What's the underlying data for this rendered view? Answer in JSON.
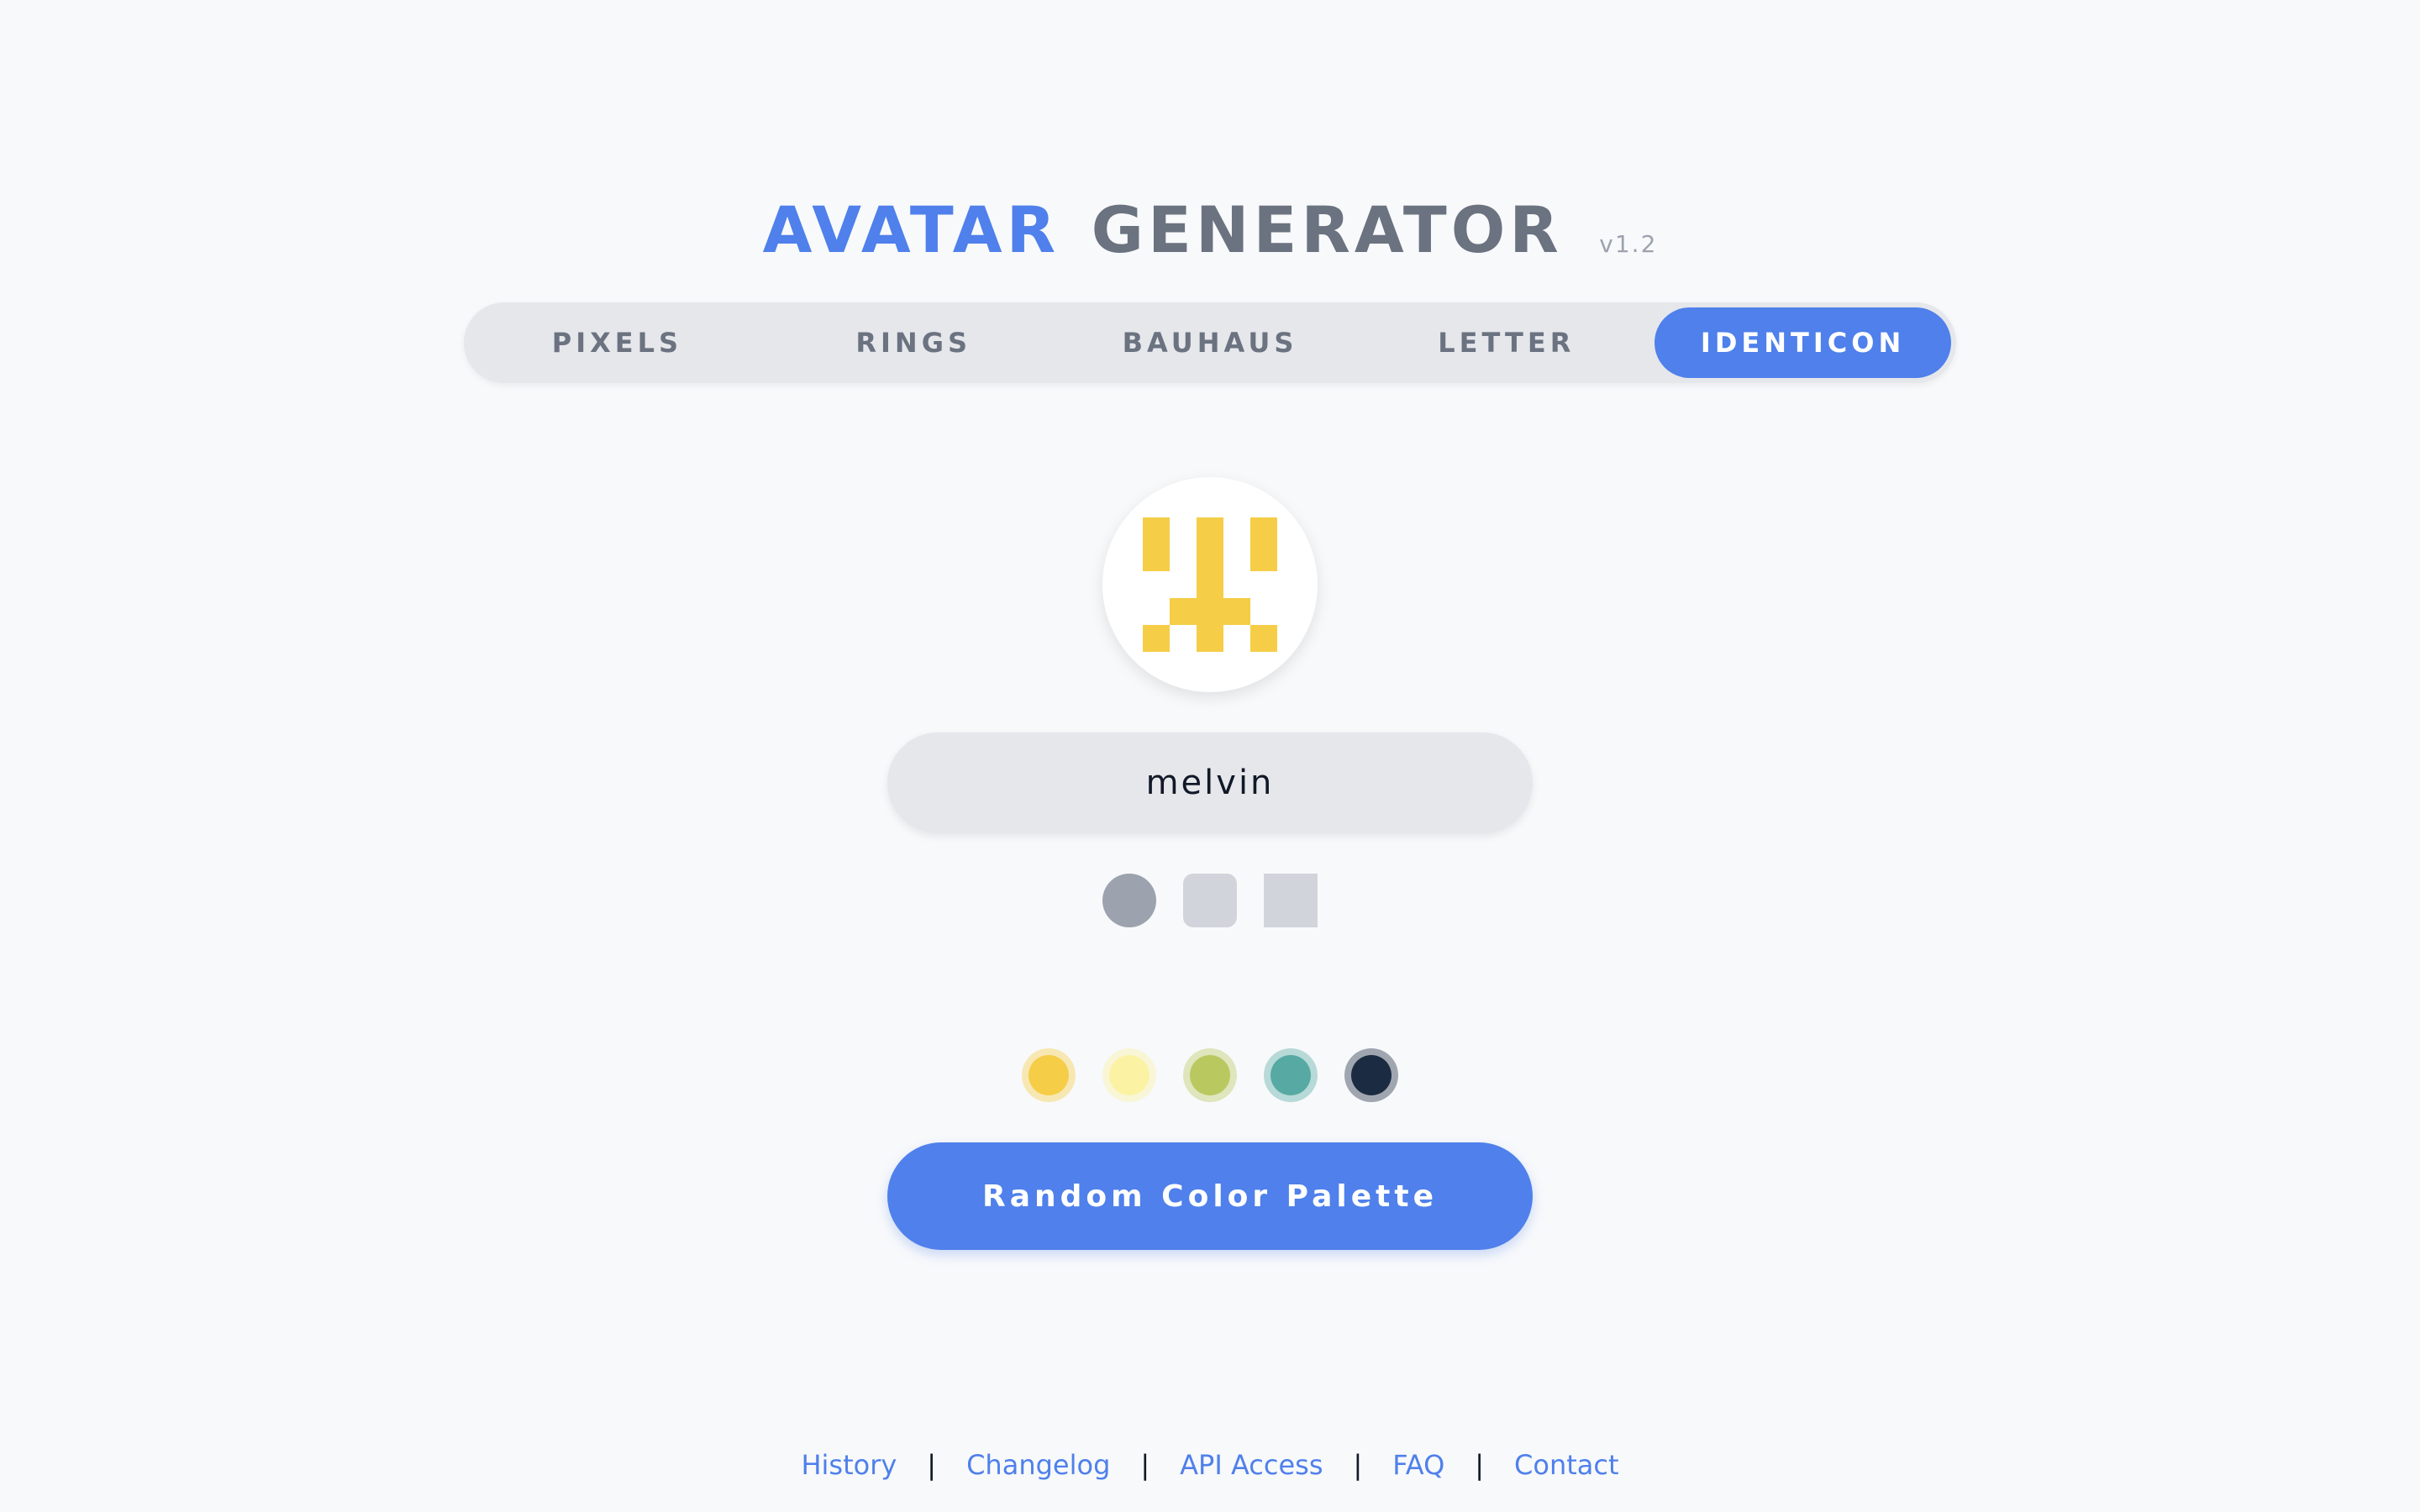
{
  "header": {
    "title_part1": "AVATAR",
    "title_part2": "GENERATOR",
    "version": "v1.2"
  },
  "tabs": [
    {
      "label": "PIXELS",
      "active": false
    },
    {
      "label": "RINGS",
      "active": false
    },
    {
      "label": "BAUHAUS",
      "active": false
    },
    {
      "label": "LETTER",
      "active": false
    },
    {
      "label": "IDENTICON",
      "active": true
    }
  ],
  "avatar": {
    "style": "identicon",
    "color": "#f5cd47",
    "background": "#ffffff"
  },
  "name_input": {
    "value": "melvin"
  },
  "shape_options": [
    {
      "name": "circle",
      "selected": true
    },
    {
      "name": "rounded-square",
      "selected": false
    },
    {
      "name": "square",
      "selected": false
    }
  ],
  "palette": {
    "colors": [
      "#f5cd47",
      "#fbf3a3",
      "#b9c95f",
      "#56aaa3",
      "#1b2b41"
    ]
  },
  "random_button": {
    "label": "Random Color Palette"
  },
  "footer": {
    "links": [
      "History",
      "Changelog",
      "API Access",
      "FAQ",
      "Contact"
    ],
    "separator": "|"
  },
  "colors": {
    "accent": "#4f80eb",
    "muted_text": "#6b7280",
    "tab_background": "#e5e7eb",
    "page_background": "#f8f9fb"
  }
}
